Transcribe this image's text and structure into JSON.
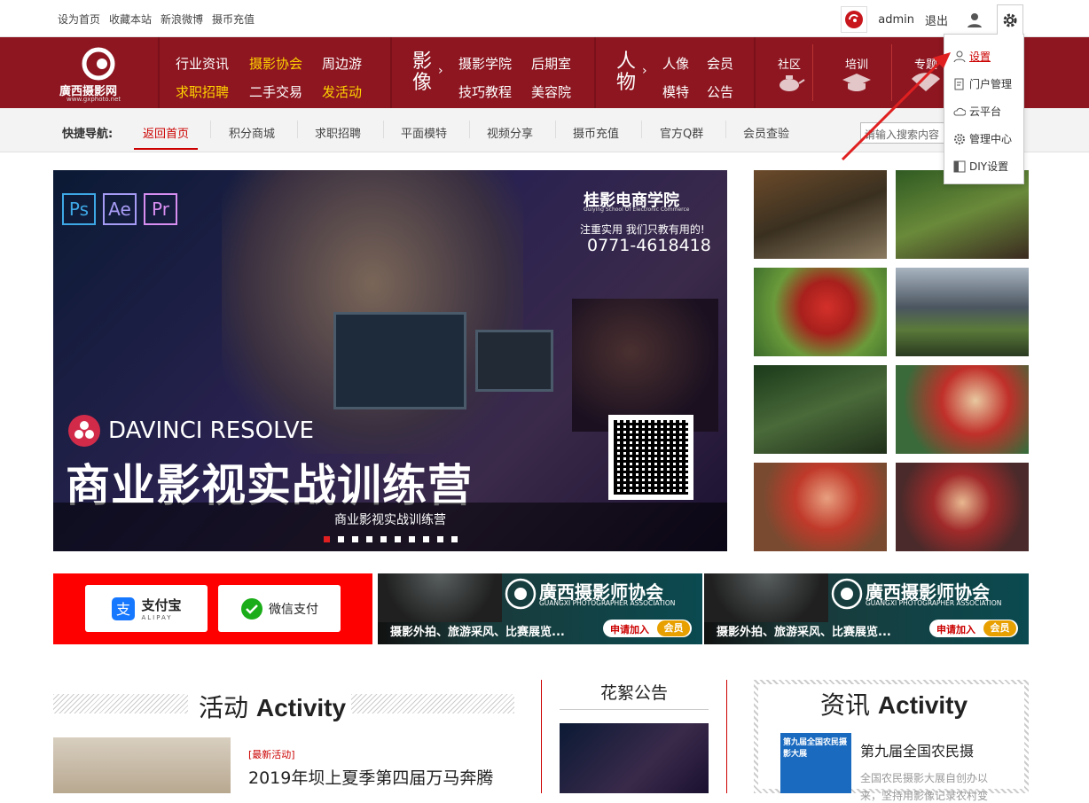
{
  "topbar": {
    "links": [
      "设为首页",
      "收藏本站",
      "新浪微博",
      "摄币充值"
    ],
    "user": "admin",
    "logout": "退出"
  },
  "logo": {
    "name": "廣西摄影网",
    "url_text": "www.gxphoto.net"
  },
  "mainnav": {
    "group1": [
      {
        "label": "行业资讯",
        "highlight": false
      },
      {
        "label": "摄影协会",
        "highlight": true
      },
      {
        "label": "周边游",
        "highlight": false
      },
      {
        "label": "求职招聘",
        "highlight": true
      },
      {
        "label": "二手交易",
        "highlight": false
      },
      {
        "label": "发活动",
        "highlight": true
      }
    ],
    "group2_title": "影像",
    "group2": [
      "摄影学院",
      "后期室",
      "技巧教程",
      "美容院"
    ],
    "group3_title": "人物",
    "group3": [
      "人像",
      "会员",
      "模特",
      "公告"
    ],
    "icons": [
      "社区",
      "培训",
      "专题"
    ]
  },
  "quicknav": {
    "title": "快捷导航:",
    "items": [
      "返回首页",
      "积分商城",
      "求职招聘",
      "平面模特",
      "视频分享",
      "摄币充值",
      "官方Q群",
      "会员查验"
    ],
    "active": 0,
    "search_placeholder": "请输入搜索内容"
  },
  "dropdown": {
    "items": [
      "设置",
      "门户管理",
      "云平台",
      "管理中心",
      "DIY设置"
    ]
  },
  "slider": {
    "brand": "桂影电商学院",
    "brand_sub": "Guiying School Of Electronic Commerce",
    "slogan": "注重实用 我们只教有用的!",
    "phone": "0771-4618418",
    "product": "DAVINCI RESOLVE",
    "headline": "商业影视实战训练营",
    "caption": "商业影视实战训练营",
    "apps": [
      "Ps",
      "Ae",
      "Pr"
    ],
    "dots": 10,
    "active_dot": 0
  },
  "banners": {
    "alipay": "支付宝",
    "alipay_sub": "ALIPAY",
    "wechat": "微信支付",
    "assoc": "廣西摄影师协会",
    "assoc_en": "GUANGXI PHOTOGRAPHER ASSOCIATION",
    "assoc_desc": "摄影外拍、旅游采风、比赛展览...",
    "join": "申请加入",
    "member": "会员"
  },
  "activity": {
    "title_cn": "活动",
    "title_en": "Activity",
    "tag": "[最新活动]",
    "headline": "2019年坝上夏季第四届万马奔腾"
  },
  "notice": {
    "title": "花絮公告"
  },
  "news": {
    "title_cn": "资讯",
    "title_en": "Activity",
    "headline": "第九届全国农民摄",
    "desc1": "全国农民摄影大展自创办以",
    "desc2": "来，坚持用影像记录农村变",
    "thumb_text": "第九届全国农民摄影大展"
  }
}
